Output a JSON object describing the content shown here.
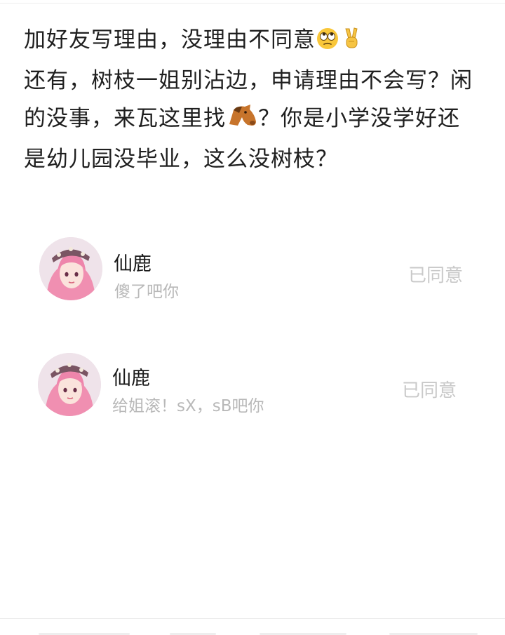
{
  "post": {
    "line1": "加好友写理由，没理由不同意",
    "line2": "还有，树枝一姐别沾边，申请理由不会写？闲的没事，来瓦这里找",
    "line3": "？你是小学没学好还是幼儿园没毕业，这么没树枝？",
    "emoji_icons": [
      "eye-roll-emoji-icon",
      "victory-hand-emoji-icon",
      "horse-face-emoji-icon"
    ]
  },
  "requests": [
    {
      "name": "仙鹿",
      "message": "傻了吧你",
      "status": "已同意"
    },
    {
      "name": "仙鹿",
      "message": "给姐滚！sX，sB吧你",
      "status": "已同意"
    }
  ]
}
